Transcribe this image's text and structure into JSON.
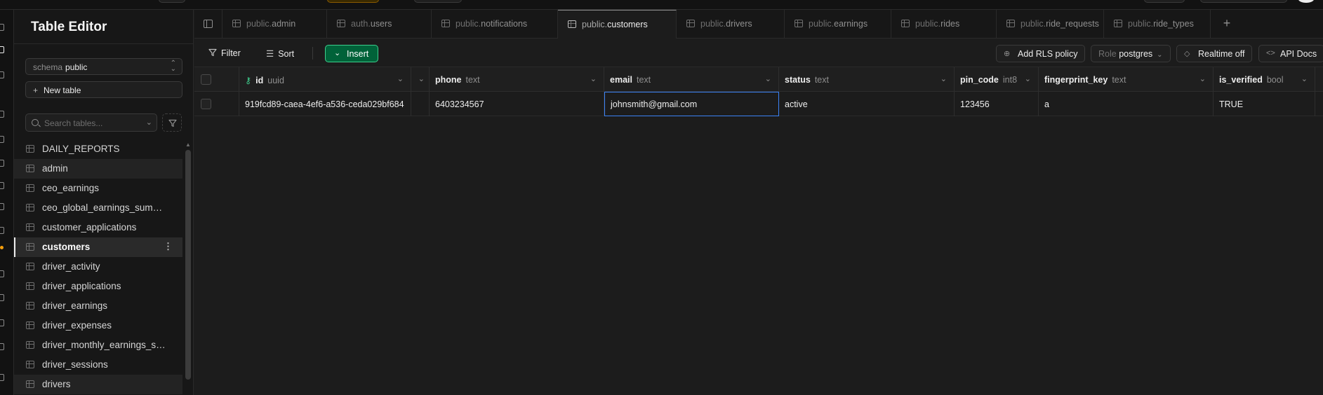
{
  "sidebar": {
    "title": "Table Editor",
    "schema_label": "schema",
    "schema_value": "public",
    "new_table_label": "New table",
    "search_placeholder": "Search tables...",
    "tables": [
      {
        "label": "DAILY_REPORTS",
        "state": "normal"
      },
      {
        "label": "admin",
        "state": "hover"
      },
      {
        "label": "ceo_earnings",
        "state": "normal"
      },
      {
        "label": "ceo_global_earnings_sum…",
        "state": "normal"
      },
      {
        "label": "customer_applications",
        "state": "normal"
      },
      {
        "label": "customers",
        "state": "active"
      },
      {
        "label": "driver_activity",
        "state": "normal"
      },
      {
        "label": "driver_applications",
        "state": "normal"
      },
      {
        "label": "driver_earnings",
        "state": "normal"
      },
      {
        "label": "driver_expenses",
        "state": "normal"
      },
      {
        "label": "driver_monthly_earnings_s…",
        "state": "normal"
      },
      {
        "label": "driver_sessions",
        "state": "normal"
      },
      {
        "label": "drivers",
        "state": "hover"
      }
    ]
  },
  "tabs": [
    {
      "schema": "public.",
      "name": "admin",
      "active": false
    },
    {
      "schema": "auth.",
      "name": "users",
      "active": false
    },
    {
      "schema": "public.",
      "name": "notifications",
      "active": false
    },
    {
      "schema": "public.",
      "name": "customers",
      "active": true
    },
    {
      "schema": "public.",
      "name": "drivers",
      "active": false
    },
    {
      "schema": "public.",
      "name": "earnings",
      "active": false
    },
    {
      "schema": "public.",
      "name": "rides",
      "active": false
    },
    {
      "schema": "public.",
      "name": "ride_requests",
      "active": false
    },
    {
      "schema": "public.",
      "name": "ride_types",
      "active": false
    }
  ],
  "toolbar": {
    "filter_label": "Filter",
    "sort_label": "Sort",
    "insert_label": "Insert",
    "rls_label": "Add RLS policy",
    "role_label": "Role",
    "role_value": "postgres",
    "realtime_label": "Realtime off",
    "api_docs_label": "API Docs"
  },
  "grid": {
    "columns": [
      {
        "name": "id",
        "type": "uuid",
        "primary_key": true
      },
      {
        "name": "phone",
        "type": "text"
      },
      {
        "name": "email",
        "type": "text"
      },
      {
        "name": "status",
        "type": "text"
      },
      {
        "name": "pin_code",
        "type": "int8"
      },
      {
        "name": "fingerprint_key",
        "type": "text"
      },
      {
        "name": "is_verified",
        "type": "bool"
      }
    ],
    "rows": [
      {
        "id": "919fcd89-caea-4ef6-a536-ceda029bf684",
        "phone": "6403234567",
        "email": "johnsmith@gmail.com",
        "status": "active",
        "pin_code": "123456",
        "fingerprint_key": "a",
        "is_verified": "TRUE"
      }
    ]
  },
  "colors": {
    "accent_green": "#3ecf8e",
    "insert_bg": "#006239",
    "selection_blue": "#3b82f6",
    "status_dot": "#f59e0b"
  }
}
